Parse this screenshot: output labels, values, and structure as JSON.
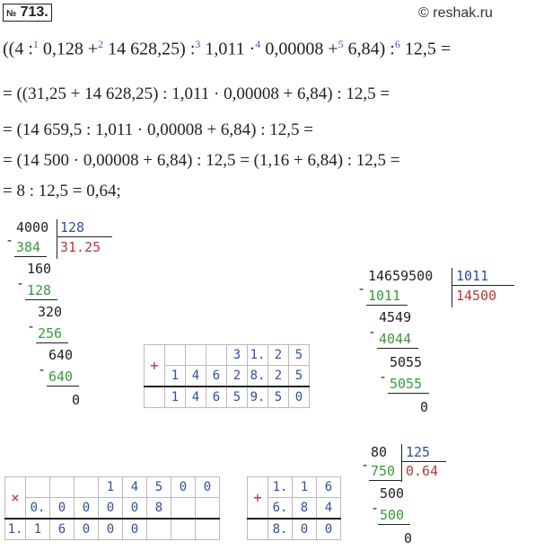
{
  "header": {
    "number_prefix": "№",
    "number": "713.",
    "credit": "© reshak.ru"
  },
  "expression": {
    "open": "((4 :",
    "o1": "1",
    "a": "0,128 +",
    "o2": "2",
    "b": "14 628,25) :",
    "o3": "3",
    "c": "1,011 ·",
    "o4": "4",
    "d": "0,00008 +",
    "o5": "5",
    "e": "6,84) :",
    "o6": "6",
    "f": "12,5 ="
  },
  "steps": [
    "= ((31,25 + 14 628,25) : 1,011 · 0,00008 + 6,84) : 12,5 =",
    "= (14 659,5 : 1,011 · 0,00008 + 6,84) : 12,5 =",
    "= (14 500 · 0,00008 + 6,84) : 12,5 = (1,16 + 6,84) : 12,5 =",
    "= 8 : 12,5 = 0,64;"
  ],
  "div1": {
    "dividend": "4000",
    "divisor": "128",
    "quotient": "31.25",
    "lines": [
      {
        "text": "384",
        "color": "grn"
      },
      {
        "text": "160",
        "color": "blk"
      },
      {
        "text": "128",
        "color": "grn"
      },
      {
        "text": "320",
        "color": "blk"
      },
      {
        "text": "256",
        "color": "grn"
      },
      {
        "text": "640",
        "color": "blk"
      },
      {
        "text": "640",
        "color": "grn"
      },
      {
        "text": "0",
        "color": "blk"
      }
    ],
    "minus": "-"
  },
  "add1": {
    "op": "+",
    "row1": [
      "",
      "",
      "",
      "",
      "3",
      "1.",
      "2",
      "5"
    ],
    "row2": [
      "",
      "1",
      "4",
      "6",
      "2",
      "8.",
      "2",
      "5"
    ],
    "row3": [
      "",
      "1",
      "4",
      "6",
      "5",
      "9.",
      "5",
      "0"
    ]
  },
  "div2": {
    "dividend": "14659500",
    "divisor": "1011",
    "quotient": "14500",
    "lines": [
      {
        "text": "1011",
        "color": "grn"
      },
      {
        "text": "4549",
        "color": "blk"
      },
      {
        "text": "4044",
        "color": "grn"
      },
      {
        "text": "5055",
        "color": "blk"
      },
      {
        "text": "5055",
        "color": "grn"
      },
      {
        "text": "0",
        "color": "blk"
      }
    ],
    "minus": "-"
  },
  "mul1": {
    "op": "×",
    "row1": [
      "",
      "",
      "",
      "",
      "1",
      "4",
      "5",
      "0",
      "0"
    ],
    "row2": [
      "",
      "0.",
      "0",
      "0",
      "0",
      "0",
      "8",
      "",
      ""
    ],
    "row3": [
      "1.",
      "1",
      "6",
      "0",
      "0",
      "0",
      "",
      "",
      ""
    ]
  },
  "add2": {
    "op": "+",
    "row1": [
      "",
      "1.",
      "1",
      "6"
    ],
    "row2": [
      "",
      "6.",
      "8",
      "4"
    ],
    "row3": [
      "",
      "8.",
      "0",
      "0"
    ]
  },
  "div3": {
    "dividend": "80",
    "divisor": "125",
    "quotient": "0.64",
    "lines": [
      {
        "text": "750",
        "color": "grn"
      },
      {
        "text": "500",
        "color": "blk"
      },
      {
        "text": "500",
        "color": "grn"
      },
      {
        "text": "0",
        "color": "blk"
      }
    ],
    "minus": "-"
  }
}
